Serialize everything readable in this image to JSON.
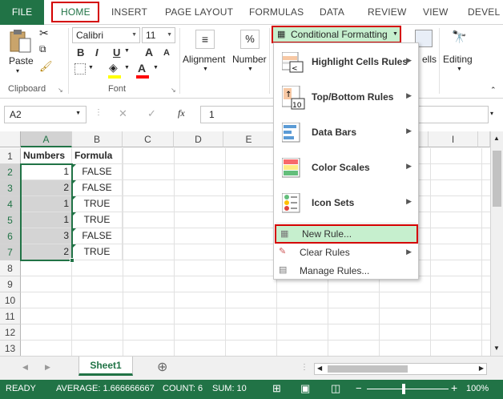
{
  "tabs": {
    "file": "FILE",
    "home": "HOME",
    "insert": "INSERT",
    "page_layout": "PAGE LAYOUT",
    "formulas": "FORMULAS",
    "data": "DATA",
    "review": "REVIEW",
    "view": "VIEW",
    "developer": "DEVEL"
  },
  "ribbon": {
    "paste": "Paste",
    "clipboard": "Clipboard",
    "font_name": "Calibri",
    "font_size": "11",
    "bold": "B",
    "italic": "I",
    "underline": "U",
    "grow": "A",
    "shrink": "A",
    "font": "Font",
    "alignment": "Alignment",
    "number": "Number",
    "percent": "%",
    "cells": "ells",
    "editing": "Editing",
    "conditional_formatting": "Conditional Formatting"
  },
  "formula_bar": {
    "name_box": "A2",
    "fx": "fx",
    "cancel": "✕",
    "enter": "✓",
    "value": "1"
  },
  "columns": [
    "A",
    "B",
    "C",
    "D",
    "E",
    "I"
  ],
  "rows": [
    "1",
    "2",
    "3",
    "4",
    "5",
    "6",
    "7",
    "8",
    "9",
    "10",
    "11",
    "12",
    "13"
  ],
  "headers": {
    "a1": "Numbers",
    "b1": "Formula"
  },
  "data_rows": [
    {
      "num": "1",
      "formula": "FALSE"
    },
    {
      "num": "2",
      "formula": "FALSE"
    },
    {
      "num": "1",
      "formula": "TRUE"
    },
    {
      "num": "1",
      "formula": "TRUE"
    },
    {
      "num": "3",
      "formula": "FALSE"
    },
    {
      "num": "2",
      "formula": "TRUE"
    }
  ],
  "menu": {
    "highlight": "Highlight Cells Rules",
    "topbottom": "Top/Bottom Rules",
    "databars": "Data Bars",
    "colorscales": "Color Scales",
    "iconsets": "Icon Sets",
    "newrule": "New Rule...",
    "clearrules": "Clear Rules",
    "managerules": "Manage Rules..."
  },
  "sheet": {
    "name": "Sheet1",
    "add": "⊕"
  },
  "status": {
    "ready": "READY",
    "average": "AVERAGE: 1.666666667",
    "count": "COUNT: 6",
    "sum": "SUM: 10",
    "zoom": "100%"
  },
  "colors": {
    "excel_green": "#217346",
    "highlight_red": "#d40000"
  }
}
